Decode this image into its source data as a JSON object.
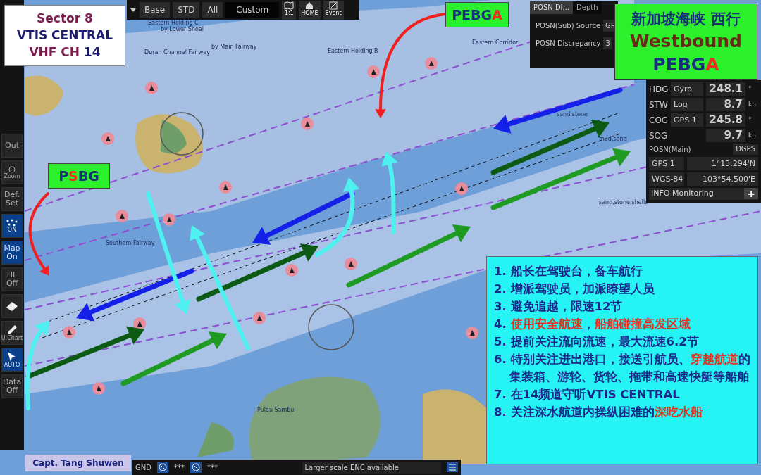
{
  "sector_box": {
    "lines": [
      {
        "segments": [
          {
            "text": "Sector 8",
            "accent": true
          }
        ]
      },
      {
        "segments": [
          {
            "text": "VTIS CENTRAL",
            "accent": false
          }
        ]
      },
      {
        "segments": [
          {
            "text": "VHF CH",
            "accent": true
          },
          {
            "text": " 14",
            "accent": false
          }
        ]
      }
    ]
  },
  "top_toolbar": {
    "buttons": [
      {
        "label": "Base"
      },
      {
        "label": "STD"
      },
      {
        "label": "All"
      }
    ],
    "dropdown": "Custom",
    "icon_buttons": [
      {
        "label": "1:1",
        "kind": "chart"
      },
      {
        "label": "HOME",
        "kind": "home"
      },
      {
        "label": "Event",
        "kind": "event"
      }
    ]
  },
  "left_toolbar": [
    {
      "label": "Out",
      "kind": "text",
      "on": false
    },
    {
      "label": "Zoom",
      "kind": "zoom",
      "on": false
    },
    {
      "label": "Def. Set",
      "kind": "text",
      "on": false
    },
    {
      "label": "ON",
      "kind": "radar",
      "on": true
    },
    {
      "label": "Map On",
      "kind": "text",
      "on": true
    },
    {
      "label": "HL Off",
      "kind": "text",
      "on": false
    },
    {
      "kind": "eraser",
      "on": false
    },
    {
      "label": "U.Chart",
      "kind": "pencil",
      "on": false
    },
    {
      "label": "AUTO",
      "kind": "cursor",
      "on": true
    },
    {
      "label": "Data Off",
      "kind": "text",
      "on": false
    }
  ],
  "pilot_labels": [
    {
      "segments": [
        {
          "text": "PEBG",
          "accent": false
        },
        {
          "text": "A",
          "accent": true
        }
      ]
    },
    {
      "segments": [
        {
          "text": "P",
          "accent": false
        },
        {
          "text": "S",
          "accent": true
        },
        {
          "text": "BG",
          "accent": false
        }
      ]
    }
  ],
  "route_box": {
    "title": "新加坡海峡 西行",
    "direction": "Westbound",
    "segments": [
      {
        "text": "PEBG",
        "accent": false
      },
      {
        "text": "A",
        "accent": true
      }
    ]
  },
  "posn_panel": {
    "tabs": [
      {
        "label": "POSN DI...",
        "selected": true
      },
      {
        "label": "Depth",
        "selected": false
      }
    ],
    "rows": [
      {
        "label": "POSN(Sub) Source",
        "value": "GP"
      },
      {
        "label": "POSN Discrepancy",
        "value": "3"
      }
    ]
  },
  "nav_data": [
    {
      "label": "HDG",
      "source": "Gyro",
      "value": "248.1",
      "unit": "°"
    },
    {
      "label": "STW",
      "source": "Log",
      "value": "8.7",
      "unit": "kn"
    },
    {
      "label": "COG",
      "source": "GPS 1",
      "value": "245.8",
      "unit": "°"
    },
    {
      "label": "SOG",
      "value": "9.7",
      "unit": "kn"
    }
  ],
  "posn_main": {
    "title": "POSN(Main)",
    "mode": "DGPS",
    "source": "GPS 1",
    "lat": "1°13.294'N",
    "datum": "WGS-84",
    "lon": "103°54.500'E"
  },
  "info_monitoring": {
    "label": "INFO Monitoring",
    "button": "+"
  },
  "chart_labels": [
    "Eastern Holding C",
    "by Lower Shoal",
    "Duran Channel Fairway",
    "by Main Fairway",
    "Eastern Holding B",
    "Eastern Corridor",
    "mud,sand",
    "sand,stone",
    "sand,stone,shells",
    "Southern Fairway",
    "Pulau Sambu"
  ],
  "notes": [
    {
      "number": "1.",
      "segments": [
        {
          "text": "船长在驾驶台，备车航行",
          "accent": false
        }
      ]
    },
    {
      "number": "2.",
      "segments": [
        {
          "text": "增派驾驶员，加派瞭望人员",
          "accent": false
        }
      ]
    },
    {
      "number": "3.",
      "segments": [
        {
          "text": "避免追越，限速12节",
          "accent": false
        }
      ]
    },
    {
      "number": "4.",
      "segments": [
        {
          "text": "使用安全航速",
          "accent": true
        },
        {
          "text": "，",
          "accent": false
        },
        {
          "text": "船舶碰撞高发区域",
          "accent": true
        }
      ]
    },
    {
      "number": "5.",
      "segments": [
        {
          "text": "提前关注流向流速，最大流速6.2节",
          "accent": false
        }
      ]
    },
    {
      "number": "6.",
      "segments": [
        {
          "text": "特别关注进出港口，接送引航员、",
          "accent": false
        },
        {
          "text": "穿越航道",
          "accent": true
        },
        {
          "text": "的集装箱、游轮、货轮、拖带和高速快艇等船舶",
          "accent": false
        }
      ]
    },
    {
      "number": "7.",
      "segments": [
        {
          "text": "在14频道守听VTIS CENTRAL",
          "accent": false
        }
      ]
    },
    {
      "number": "8.",
      "segments": [
        {
          "text": "关注深水航道内操纵困难的",
          "accent": false
        },
        {
          "text": "深吃水船",
          "accent": true
        }
      ]
    }
  ],
  "captain_label": "Capt. Tang Shuwen",
  "status_bar": {
    "mode": "GND",
    "targets": [
      {
        "label": "***"
      },
      {
        "label": "***"
      }
    ],
    "message": "Larger scale ENC available"
  }
}
